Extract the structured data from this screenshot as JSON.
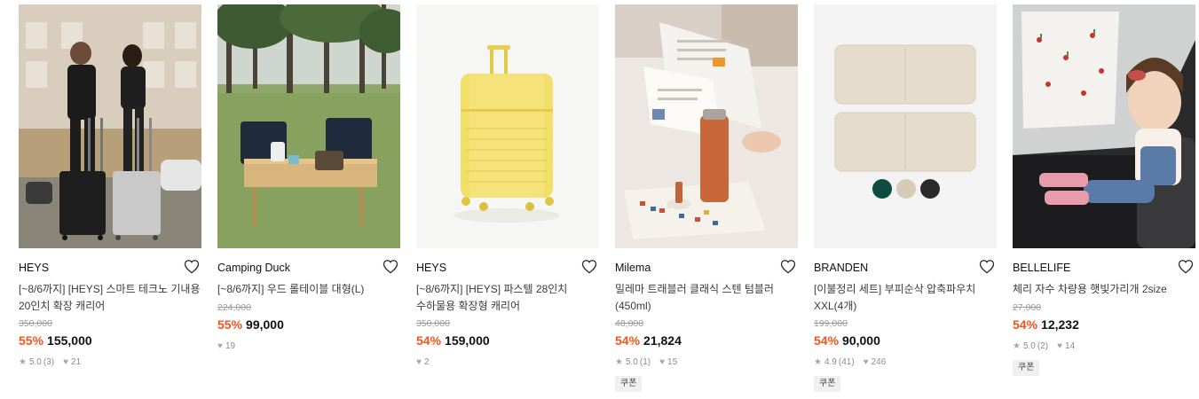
{
  "products": [
    {
      "brand": "HEYS",
      "title": "[~8/6까지] [HEYS] 스마트 테크노 기내용 20인치 확장 캐리어",
      "original_price": "350,000",
      "discount": "55%",
      "price": "155,000",
      "rating": "5.0",
      "review_count": "(3)",
      "likes": "21",
      "coupon": ""
    },
    {
      "brand": "Camping Duck",
      "title": "[~8/6까지] 우드 롤테이블 대형(L)",
      "original_price": "224,000",
      "discount": "55%",
      "price": "99,000",
      "rating": "",
      "review_count": "",
      "likes": "19",
      "coupon": ""
    },
    {
      "brand": "HEYS",
      "title": "[~8/6까지] [HEYS] 파스텔 28인치 수하물용 확장형 캐리어",
      "original_price": "350,000",
      "discount": "54%",
      "price": "159,000",
      "rating": "",
      "review_count": "",
      "likes": "2",
      "coupon": ""
    },
    {
      "brand": "Milema",
      "title": "밀레마 트래블러 클래식 스텐 텀블러 (450ml)",
      "original_price": "48,000",
      "discount": "54%",
      "price": "21,824",
      "rating": "5.0",
      "review_count": "(1)",
      "likes": "15",
      "coupon": "쿠폰"
    },
    {
      "brand": "BRANDEN",
      "title": "[이불정리 세트] 부피순삭 압축파우치 XXL(4개)",
      "original_price": "199,000",
      "discount": "54%",
      "price": "90,000",
      "rating": "4.9",
      "review_count": "(41)",
      "likes": "246",
      "coupon": "쿠폰"
    },
    {
      "brand": "BELLELIFE",
      "title": "체리 자수 차량용 햇빛가리개 2size",
      "original_price": "27,000",
      "discount": "54%",
      "price": "12,232",
      "rating": "5.0",
      "review_count": "(2)",
      "likes": "14",
      "coupon": "쿠폰"
    }
  ],
  "icons": {
    "wishlist": "heart-outline-icon",
    "rating": "star-icon",
    "likes": "heart-filled-icon"
  },
  "colors": {
    "discount": "#f2541b",
    "text": "#111111",
    "muted": "#9a9a9a",
    "coupon_bg": "#f0f0f0"
  }
}
